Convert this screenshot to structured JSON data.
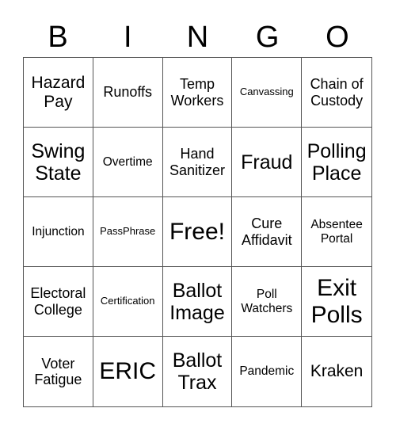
{
  "header": {
    "letters": [
      "B",
      "I",
      "N",
      "G",
      "O"
    ]
  },
  "cells": [
    {
      "text": "Hazard Pay",
      "size": "s-lg"
    },
    {
      "text": "Runoffs",
      "size": "s-md"
    },
    {
      "text": "Temp Workers",
      "size": "s-md"
    },
    {
      "text": "Canvassing",
      "size": "s-xs"
    },
    {
      "text": "Chain of Custody",
      "size": "s-md"
    },
    {
      "text": "Swing State",
      "size": "s-xl"
    },
    {
      "text": "Overtime",
      "size": "s-sm"
    },
    {
      "text": "Hand Sanitizer",
      "size": "s-md"
    },
    {
      "text": "Fraud",
      "size": "s-xl"
    },
    {
      "text": "Polling Place",
      "size": "s-xl"
    },
    {
      "text": "Injunction",
      "size": "s-sm"
    },
    {
      "text": "PassPhrase",
      "size": "s-xs"
    },
    {
      "text": "Free!",
      "size": "s-xxl"
    },
    {
      "text": "Cure Affidavit",
      "size": "s-md"
    },
    {
      "text": "Absentee Portal",
      "size": "s-sm"
    },
    {
      "text": "Electoral College",
      "size": "s-md"
    },
    {
      "text": "Certification",
      "size": "s-xs"
    },
    {
      "text": "Ballot Image",
      "size": "s-xl"
    },
    {
      "text": "Poll Watchers",
      "size": "s-sm"
    },
    {
      "text": "Exit Polls",
      "size": "s-xxl"
    },
    {
      "text": "Voter Fatigue",
      "size": "s-md"
    },
    {
      "text": "ERIC",
      "size": "s-xxl"
    },
    {
      "text": "Ballot Trax",
      "size": "s-xl"
    },
    {
      "text": "Pandemic",
      "size": "s-sm"
    },
    {
      "text": "Kraken",
      "size": "s-lg"
    }
  ]
}
